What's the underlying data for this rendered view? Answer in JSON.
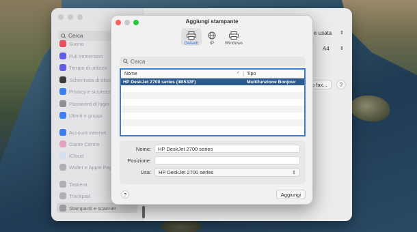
{
  "colors": {
    "close": "#fe5f57",
    "minimize": "#febc2e",
    "zoom": "#28c840",
    "selection": "#2c5a8c",
    "focus_ring": "#3b7bd0",
    "accent": "#2a6fd6"
  },
  "settings": {
    "search_placeholder": "Cerca",
    "sidebar_items": [
      {
        "label": "Suono",
        "icon": "speaker-icon",
        "color": "#e94e5b"
      },
      {
        "label": "Full Immersion",
        "icon": "moon-icon",
        "color": "#5e5ce6"
      },
      {
        "label": "Tempo di utilizzo",
        "icon": "hourglass-icon",
        "color": "#5e5ce6"
      },
      {
        "label": "Schermata di blocco",
        "icon": "lock-screen-icon",
        "color": "#3a3a3c"
      },
      {
        "label": "Privacy e sicurezza",
        "icon": "hand-icon",
        "color": "#3d7df5"
      },
      {
        "label": "Password di login",
        "icon": "key-icon",
        "color": "#8e8e93"
      },
      {
        "label": "Utenti e gruppi",
        "icon": "users-icon",
        "color": "#3d7df5"
      },
      {
        "label": "Account internet",
        "icon": "at-icon",
        "color": "#3d7df5"
      },
      {
        "label": "Game Center",
        "icon": "game-center-icon",
        "color": "#e3e3e3"
      },
      {
        "label": "iCloud",
        "icon": "cloud-icon",
        "color": "#dfeaf8"
      },
      {
        "label": "Wallet e Apple Pay",
        "icon": "wallet-icon",
        "color": "#1c1c1e"
      },
      {
        "label": "Tastiera",
        "icon": "keyboard-icon",
        "color": "#8e8e93"
      },
      {
        "label": "Trackpad",
        "icon": "trackpad-icon",
        "color": "#8e8e93"
      },
      {
        "label": "Stampanti e scanner",
        "icon": "printer-icon",
        "color": "#8e8e93"
      }
    ],
    "right_pane": {
      "default_label": "e usata",
      "paper_label": "A4",
      "fax_button": "o fax...",
      "help": "?"
    }
  },
  "dialog": {
    "title": "Aggiungi stampante",
    "tabs": [
      {
        "label": "Default",
        "icon": "printer-default-icon"
      },
      {
        "label": "IP",
        "icon": "globe-icon"
      },
      {
        "label": "Windows",
        "icon": "windows-printer-icon"
      }
    ],
    "search_placeholder": "Cerca",
    "table": {
      "headers": [
        "Nome",
        "Tipo"
      ],
      "rows": [
        {
          "name": "HP DeskJet 2700 series (4B533F)",
          "type": "Multifunzione Bonjour"
        }
      ]
    },
    "form": {
      "name_label": "Nome:",
      "name_value": "HP DeskJet 2700 series",
      "location_label": "Posizione:",
      "location_value": "",
      "use_label": "Usa:",
      "use_value": "HP DeskJet 2700 series"
    },
    "help": "?",
    "add_button": "Aggiungi"
  }
}
